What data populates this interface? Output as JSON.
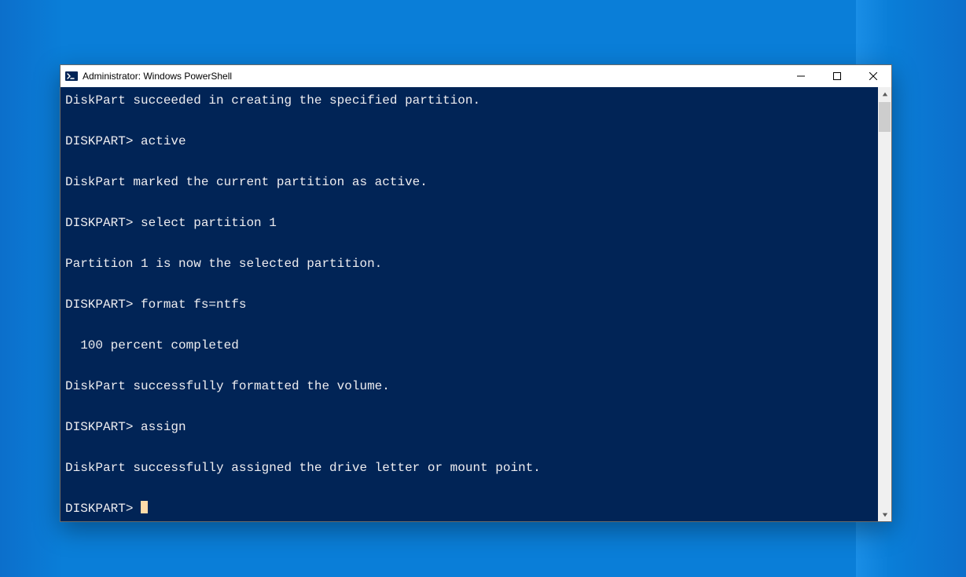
{
  "window": {
    "title": "Administrator: Windows PowerShell"
  },
  "terminal": {
    "lines": [
      "DiskPart succeeded in creating the specified partition.",
      "",
      "DISKPART> active",
      "",
      "DiskPart marked the current partition as active.",
      "",
      "DISKPART> select partition 1",
      "",
      "Partition 1 is now the selected partition.",
      "",
      "DISKPART> format fs=ntfs",
      "",
      "  100 percent completed",
      "",
      "DiskPart successfully formatted the volume.",
      "",
      "DISKPART> assign",
      "",
      "DiskPart successfully assigned the drive letter or mount point.",
      "",
      "DISKPART> "
    ]
  }
}
